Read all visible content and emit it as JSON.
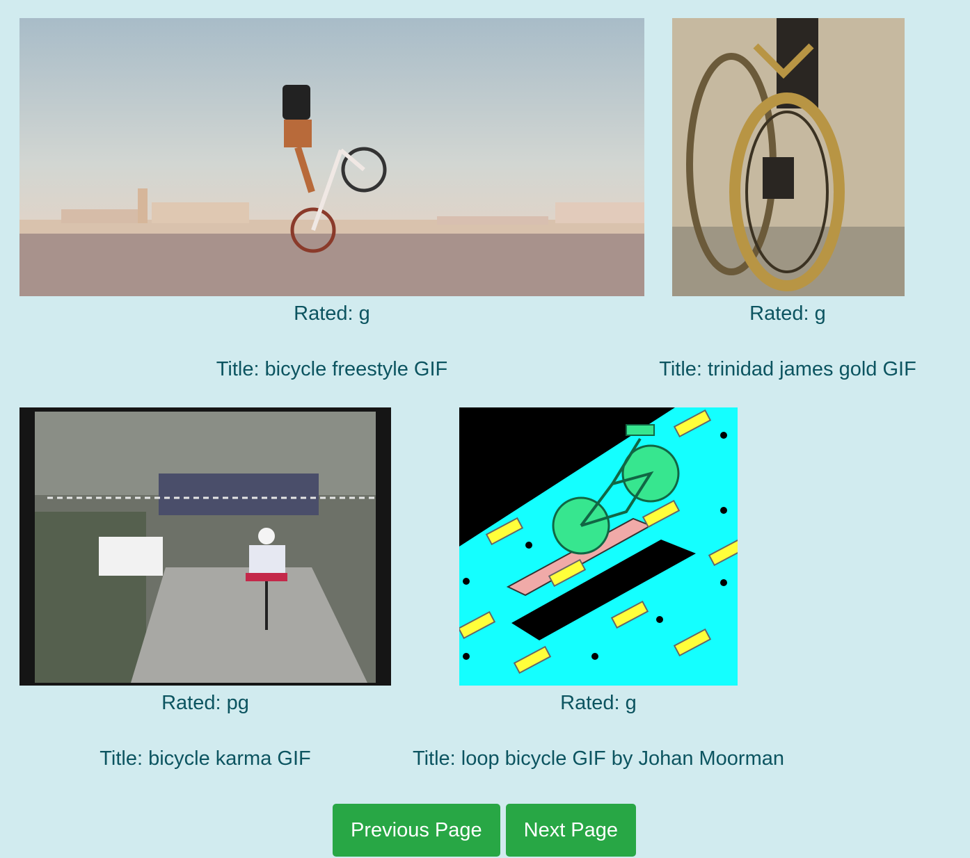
{
  "gifs": [
    {
      "rating_label": "Rated: g",
      "title_label": "Title: bicycle freestyle GIF",
      "image_icon": "bmx-stunt-rider-image"
    },
    {
      "rating_label": "Rated: g",
      "title_label": "Title: trinidad james gold GIF",
      "image_icon": "gold-bicycle-wheel-image"
    },
    {
      "rating_label": "Rated: pg",
      "title_label": "Title: bicycle karma GIF",
      "image_icon": "cyclist-race-video-image"
    },
    {
      "rating_label": "Rated: g",
      "title_label": "Title: loop bicycle GIF by Johan Moorman",
      "image_icon": "isometric-bicycle-illustration-image"
    }
  ],
  "pagination": {
    "previous_label": "Previous Page",
    "next_label": "Next Page"
  },
  "colors": {
    "page_background": "#d1ebef",
    "text": "#0c5460",
    "button": "#28a745",
    "button_text": "#ffffff"
  }
}
